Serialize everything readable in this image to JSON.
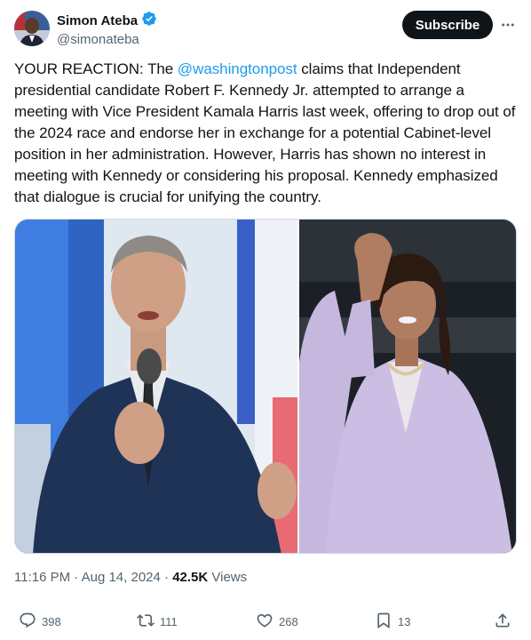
{
  "author": {
    "name": "Simon Ateba",
    "handle": "@simonateba",
    "verified": true
  },
  "subscribe_label": "Subscribe",
  "tweet": {
    "prefix": "YOUR REACTION: The ",
    "mention": "@washingtonpost",
    "body": " claims that Independent presidential candidate Robert F. Kennedy Jr. attempted to arrange a meeting with Vice President Kamala Harris last week, offering to drop out of the 2024 race and endorse her in exchange for a potential Cabinet-level position in her administration. However, Harris has shown no interest in meeting with Kennedy or considering his proposal. Kennedy emphasized that dialogue is crucial for unifying the country."
  },
  "meta": {
    "time": "11:16 PM",
    "sep1": " · ",
    "date": "Aug 14, 2024",
    "sep2": " · ",
    "views_count": "42.5K",
    "views_label": " Views"
  },
  "actions": {
    "replies": "398",
    "reposts": "111",
    "likes": "268",
    "bookmarks": "13"
  },
  "colors": {
    "accent": "#1d9bf0",
    "text": "#0f1419",
    "muted": "#536471",
    "verified": "#1d9bf0"
  },
  "icons": [
    "verified-badge-icon",
    "more-icon",
    "reply-icon",
    "repost-icon",
    "like-icon",
    "bookmark-icon",
    "share-icon"
  ]
}
